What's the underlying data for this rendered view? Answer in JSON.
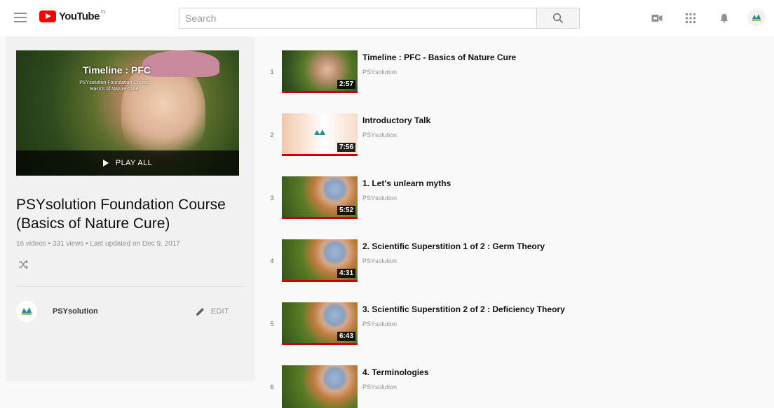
{
  "header": {
    "logo_text": "YouTube",
    "logo_sup": "IN",
    "search_placeholder": "Search"
  },
  "icons": {
    "menu": "hamburger-icon",
    "search": "search-icon",
    "upload": "video-camera-icon",
    "apps": "apps-grid-icon",
    "notifications": "bell-icon",
    "account": "avatar-icon"
  },
  "colors": {
    "brand_red": "#ff0000",
    "progress_red": "#cc0000"
  },
  "playlist": {
    "hero_title": "Timeline : PFC",
    "hero_subtitle_1": "PSYsolution Foundation Course",
    "hero_subtitle_2": "Basics of Nature Cure",
    "play_all": "PLAY ALL",
    "title_line1": "PSYsolution Foundation Course",
    "title_line2": "(Basics of Nature Cure)",
    "meta": "16 videos • 331 views • Last updated on Dec 9, 2017",
    "owner_name": "PSYsolution",
    "edit_label": "EDIT"
  },
  "videos": [
    {
      "index": "1",
      "title": "Timeline : PFC - Basics of Nature Cure",
      "channel": "PSYsolution",
      "duration": "2:57"
    },
    {
      "index": "2",
      "title": "Introductory Talk",
      "channel": "PSYsolution",
      "duration": "7:56"
    },
    {
      "index": "3",
      "title": "1. Let's unlearn myths",
      "channel": "PSYsolution",
      "duration": "5:52"
    },
    {
      "index": "4",
      "title": "2. Scientific Superstition 1 of 2 : Germ Theory",
      "channel": "PSYsolution",
      "duration": "4:31"
    },
    {
      "index": "5",
      "title": "3. Scientific Superstition 2 of 2 : Deficiency Theory",
      "channel": "PSYsolution",
      "duration": "6:43"
    },
    {
      "index": "6",
      "title": "4. Terminologies",
      "channel": "PSYsolution",
      "duration": ""
    }
  ]
}
